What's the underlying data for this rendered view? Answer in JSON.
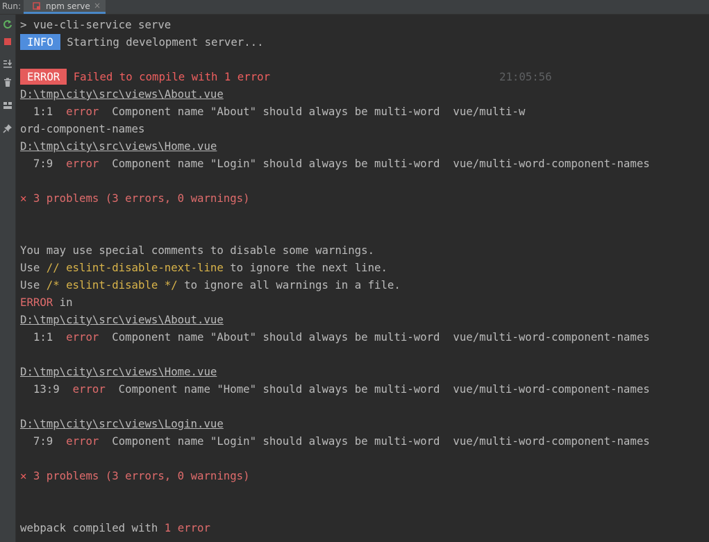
{
  "run_bar": {
    "run_label": "Run:",
    "tab_label": "npm serve",
    "tab_close": "×"
  },
  "colors": {
    "info_badge": "#4f8ddd",
    "error_badge": "#e55b5b",
    "error_text": "#e06c6c",
    "comment_highlight": "#d9b44a",
    "background": "#2b2b2b"
  },
  "console": {
    "command": "> vue-cli-service serve",
    "info_badge": "INFO",
    "info_text": "Starting development server...",
    "error_badge": "ERROR",
    "error_text": "Failed to compile with 1 error",
    "timestamp": "21:05:56",
    "block1": {
      "file_about": "D:\\tmp\\city\\src\\views\\About.vue",
      "about_pos": "  1:1  ",
      "about_sev": "error",
      "about_msg": "  Component name \"About\" should always be multi-word  vue/multi-w",
      "about_wrap": "ord-component-names",
      "file_home": "D:\\tmp\\city\\src\\views\\Home.vue",
      "home_pos": "  7:9  ",
      "home_sev": "error",
      "home_msg": "  Component name \"Login\" should always be multi-word  vue/multi-word-component-names",
      "problems_icon": "✕",
      "problems": " 3 problems (3 errors, 0 warnings)"
    },
    "hint1": "You may use special comments to disable some warnings.",
    "hint2_pre": "Use ",
    "hint2_code": "// eslint-disable-next-line",
    "hint2_post": " to ignore the next line.",
    "hint3_pre": "Use ",
    "hint3_code": "/* eslint-disable */",
    "hint3_post": " to ignore all warnings in a file.",
    "error_in_kw": "ERROR",
    "error_in_rest": " in",
    "block2": {
      "file_about": "D:\\tmp\\city\\src\\views\\About.vue",
      "about_pos": "  1:1  ",
      "about_sev": "error",
      "about_msg": "  Component name \"About\" should always be multi-word  vue/multi-word-component-names",
      "file_home": "D:\\tmp\\city\\src\\views\\Home.vue",
      "home_pos": "  13:9  ",
      "home_sev": "error",
      "home_msg": "  Component name \"Home\" should always be multi-word  vue/multi-word-component-names",
      "file_login": "D:\\tmp\\city\\src\\views\\Login.vue",
      "login_pos": "  7:9  ",
      "login_sev": "error",
      "login_msg": "  Component name \"Login\" should always be multi-word  vue/multi-word-component-names",
      "problems_icon": "✕",
      "problems": " 3 problems (3 errors, 0 warnings)"
    },
    "webpack_pre": "webpack compiled with ",
    "webpack_count": "1",
    "webpack_post": " error"
  }
}
